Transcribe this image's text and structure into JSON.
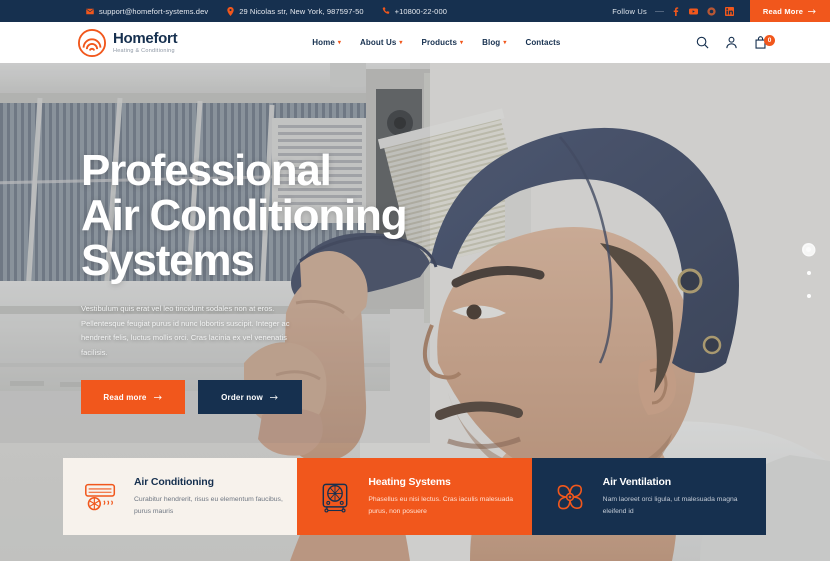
{
  "topbar": {
    "email": "support@homefort-systems.dev",
    "address": "29 Nicolas str, New York, 987597-50",
    "phone": "+10800-22-000",
    "follow_label": "Follow Us",
    "socials": [
      "facebook-icon",
      "youtube-icon",
      "instagram-icon",
      "linkedin-icon"
    ],
    "read_more_label": "Read More",
    "bg_color": "#16304f",
    "accent_color": "#f1571c"
  },
  "header": {
    "brand": "Homefort",
    "tagline": "Heating & Conditioning",
    "nav": [
      {
        "label": "Home",
        "has_dropdown": true
      },
      {
        "label": "About Us",
        "has_dropdown": true
      },
      {
        "label": "Products",
        "has_dropdown": true
      },
      {
        "label": "Blog",
        "has_dropdown": true
      },
      {
        "label": "Contacts",
        "has_dropdown": false
      }
    ],
    "icons": [
      "search-icon",
      "user-account-icon",
      "shopping-bag-icon"
    ],
    "cart_count": "0"
  },
  "hero": {
    "title_line1": "Professional",
    "title_line2": "Air Conditioning",
    "title_line3": "Systems",
    "description": "Vestibulum quis erat vel leo tincidunt sodales non at eros. Pellentesque feugiat purus id nunc lobortis suscipit. Integer ac hendrerit felis, luctus mollis orci. Cras lacinia ex vel venenatis facilisis.",
    "primary_button": "Read more",
    "secondary_button": "Order now",
    "slider_dots": 3,
    "active_dot": 1
  },
  "cards": [
    {
      "title": "Air Conditioning",
      "description": "Curabitur hendrerit, risus eu elementum faucibus, purus mauris",
      "icon": "air-conditioner-icon",
      "bg_color": "#f7f2ec"
    },
    {
      "title": "Heating Systems",
      "description": "Phasellus eu nisi lectus. Cras iaculis malesuada purus, non posuere",
      "icon": "heater-icon",
      "bg_color": "#f1571c"
    },
    {
      "title": "Air Ventilation",
      "description": "Nam laoreet orci ligula, ut malesuada magna eleifend id",
      "icon": "ventilation-fan-icon",
      "bg_color": "#16304f"
    }
  ]
}
